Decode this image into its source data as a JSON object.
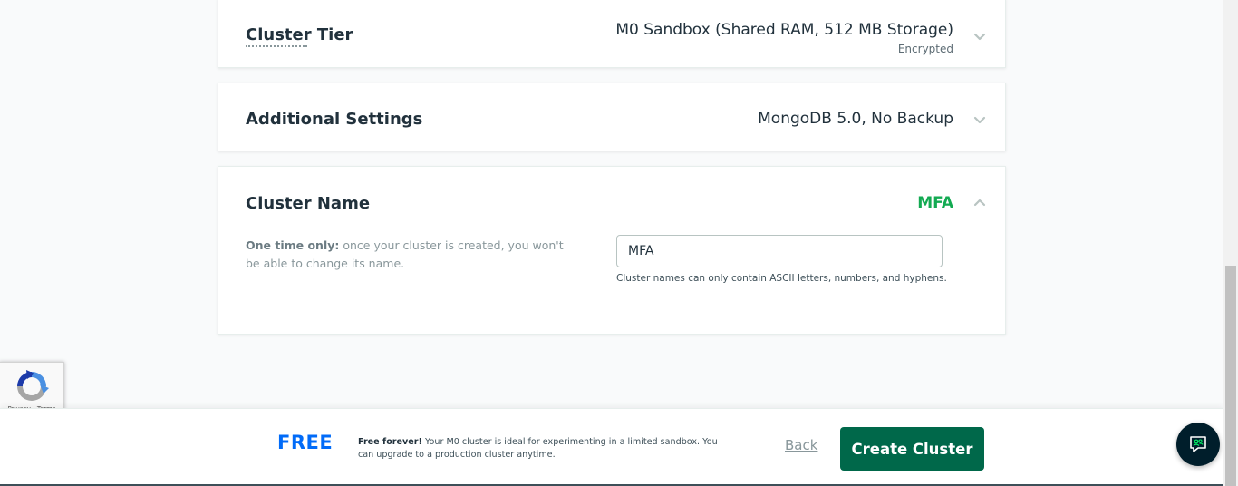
{
  "cluster_tier": {
    "title": "Cluster Tier",
    "value": "M0 Sandbox (Shared RAM, 512 MB Storage)",
    "sub_value": "Encrypted",
    "chevron": "chevron-down-icon"
  },
  "additional_settings": {
    "title": "Additional Settings",
    "value": "MongoDB 5.0, No Backup",
    "chevron": "chevron-down-icon"
  },
  "cluster_name": {
    "title": "Cluster Name",
    "value": "MFA",
    "chevron": "chevron-up-icon",
    "note_bold": "One time only:",
    "note_text": " once your cluster is created, you won't be able to change its name.",
    "input_value": "MFA",
    "hint": "Cluster names can only contain ASCII letters, numbers, and hyphens."
  },
  "recaptcha": {
    "links": "Privacy - Terms"
  },
  "footer": {
    "price_label": "FREE",
    "desc_bold": "Free forever!",
    "desc_text": " Your M0 cluster is ideal for experimenting in a limited sandbox. You can upgrade to a production cluster anytime.",
    "back_label": "Back",
    "create_label": "Create Cluster"
  },
  "colors": {
    "accent_green": "#13aa52",
    "button_green": "#00684a",
    "free_blue": "#016bf8",
    "chat_bg": "#001e2b"
  }
}
